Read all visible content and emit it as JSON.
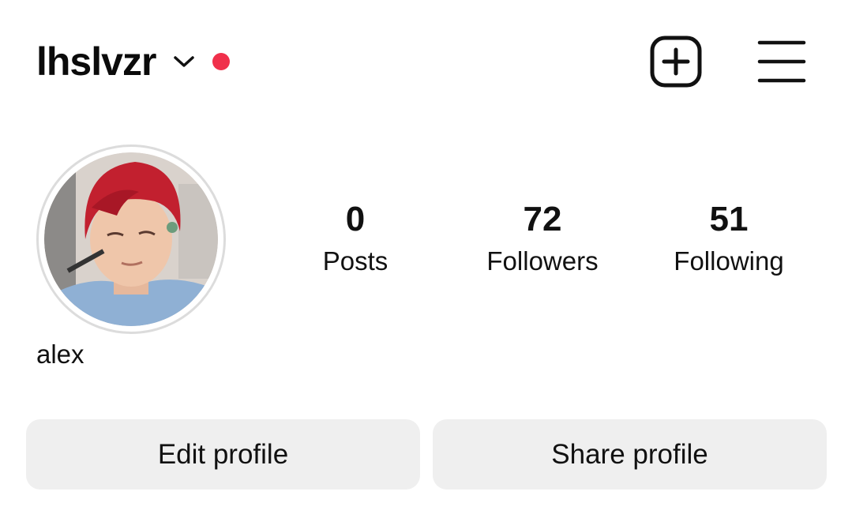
{
  "header": {
    "username": "lhslvzr",
    "chevron_icon": "chevron-down-icon",
    "notification_dot_color": "#f0304b",
    "create_icon": "plus-square-icon",
    "menu_icon": "hamburger-menu-icon"
  },
  "profile": {
    "display_name": "alex",
    "avatar_icon": "profile-photo"
  },
  "stats": {
    "posts": {
      "count": "0",
      "label": "Posts"
    },
    "followers": {
      "count": "72",
      "label": "Followers"
    },
    "following": {
      "count": "51",
      "label": "Following"
    }
  },
  "actions": {
    "edit_label": "Edit profile",
    "share_label": "Share profile",
    "button_bg": "#efefef"
  }
}
